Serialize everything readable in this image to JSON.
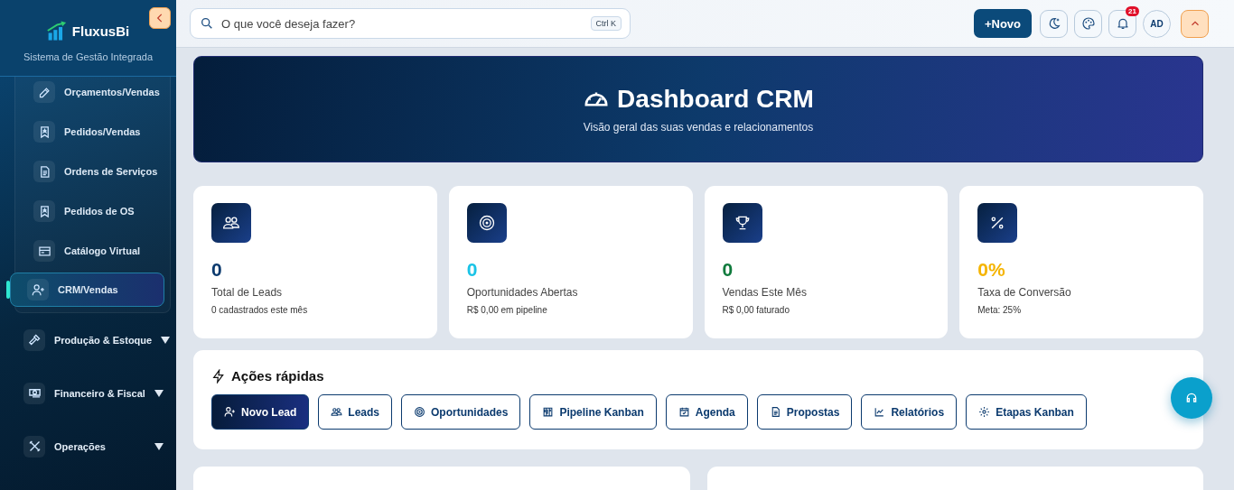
{
  "brand": {
    "name": "FluxusBi",
    "subtitle": "Sistema de Gestão Integrada"
  },
  "sidebar": {
    "submenu": [
      {
        "label": "Orçamentos/Vendas",
        "selected": false
      },
      {
        "label": "Pedidos/Vendas",
        "selected": false
      },
      {
        "label": "Ordens de Serviços",
        "selected": false
      },
      {
        "label": "Pedidos de OS",
        "selected": false
      },
      {
        "label": "Catálogo Virtual",
        "selected": false
      },
      {
        "label": "CRM/Vendas",
        "selected": true
      }
    ],
    "sections": [
      {
        "label": "Produção & Estoque",
        "expanded": false
      },
      {
        "label": "Financeiro & Fiscal",
        "expanded": false
      },
      {
        "label": "Operações",
        "expanded": false
      }
    ]
  },
  "search": {
    "placeholder": "O que você deseja fazer?",
    "shortcut": "Ctrl K"
  },
  "topbar": {
    "new_button": "+Novo",
    "notifications": "21",
    "avatar": "AD"
  },
  "hero": {
    "title": "Dashboard CRM",
    "subtitle": "Visão geral das suas vendas e relacionamentos"
  },
  "stats": [
    {
      "value": "0",
      "label": "Total de Leads",
      "note": "0 cadastrados este mês",
      "color": "#0b3a6e"
    },
    {
      "value": "0",
      "label": "Oportunidades Abertas",
      "note": "R$ 0,00 em pipeline",
      "color": "#19c3e6"
    },
    {
      "value": "0",
      "label": "Vendas Este Mês",
      "note": "R$ 0,00 faturado",
      "color": "#0f7a3c"
    },
    {
      "value": "0%",
      "label": "Taxa de Conversão",
      "note": "Meta: 25%",
      "color": "#f5b400"
    }
  ],
  "quick_actions": {
    "title": "Ações rápidas",
    "buttons": [
      {
        "label": "Novo Lead",
        "selected": true
      },
      {
        "label": "Leads",
        "selected": false
      },
      {
        "label": "Oportunidades",
        "selected": false
      },
      {
        "label": "Pipeline Kanban",
        "selected": false
      },
      {
        "label": "Agenda",
        "selected": false
      },
      {
        "label": "Propostas",
        "selected": false
      },
      {
        "label": "Relatórios",
        "selected": false
      },
      {
        "label": "Etapas Kanban",
        "selected": false
      }
    ]
  }
}
